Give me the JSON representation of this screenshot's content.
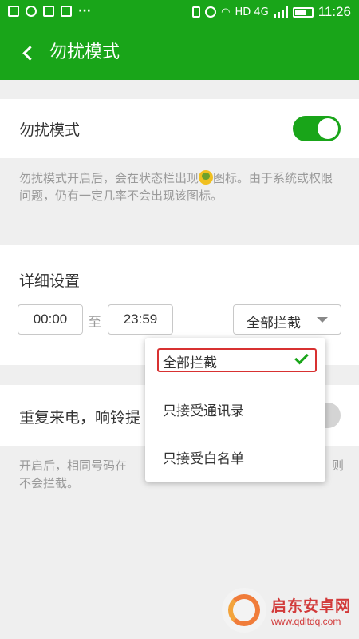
{
  "statusbar": {
    "network": "HD 4G",
    "time": "11:26",
    "icons": [
      "message-icon",
      "clover-icon",
      "image-icon",
      "gallery-icon",
      "more-icon",
      "vibrate-icon",
      "alarm-icon",
      "wifi-icon",
      "signal-icon",
      "battery-icon"
    ]
  },
  "header": {
    "back_icon": "chevron-left-icon",
    "title": "勿扰模式"
  },
  "dnd": {
    "label": "勿扰模式",
    "toggle_on": true,
    "description_before": "勿扰模式开启后，会在状态栏出现",
    "description_after": "图标。由于系统或权限问题，仍有一定几率不会出现该图标。"
  },
  "detail": {
    "title": "详细设置",
    "start_time": "00:00",
    "to_label": "至",
    "end_time": "23:59",
    "mode_selected": "全部拦截"
  },
  "repeat": {
    "label": "重复来电，响铃提",
    "toggle_on": false,
    "description_left": "开启后，相同号码在",
    "description_right": "则",
    "description_line2": "不会拦截。"
  },
  "menu": {
    "options": [
      {
        "label": "全部拦截",
        "selected": true
      },
      {
        "label": "只接受通讯录",
        "selected": false
      },
      {
        "label": "只接受白名单",
        "selected": false
      }
    ]
  },
  "watermark": {
    "name": "启东安卓网",
    "url": "www.qdltdq.com"
  },
  "colors": {
    "primary": "#19a519",
    "selection_border": "#d83131",
    "hint_text": "#9a9a9a",
    "background": "#efefef"
  }
}
